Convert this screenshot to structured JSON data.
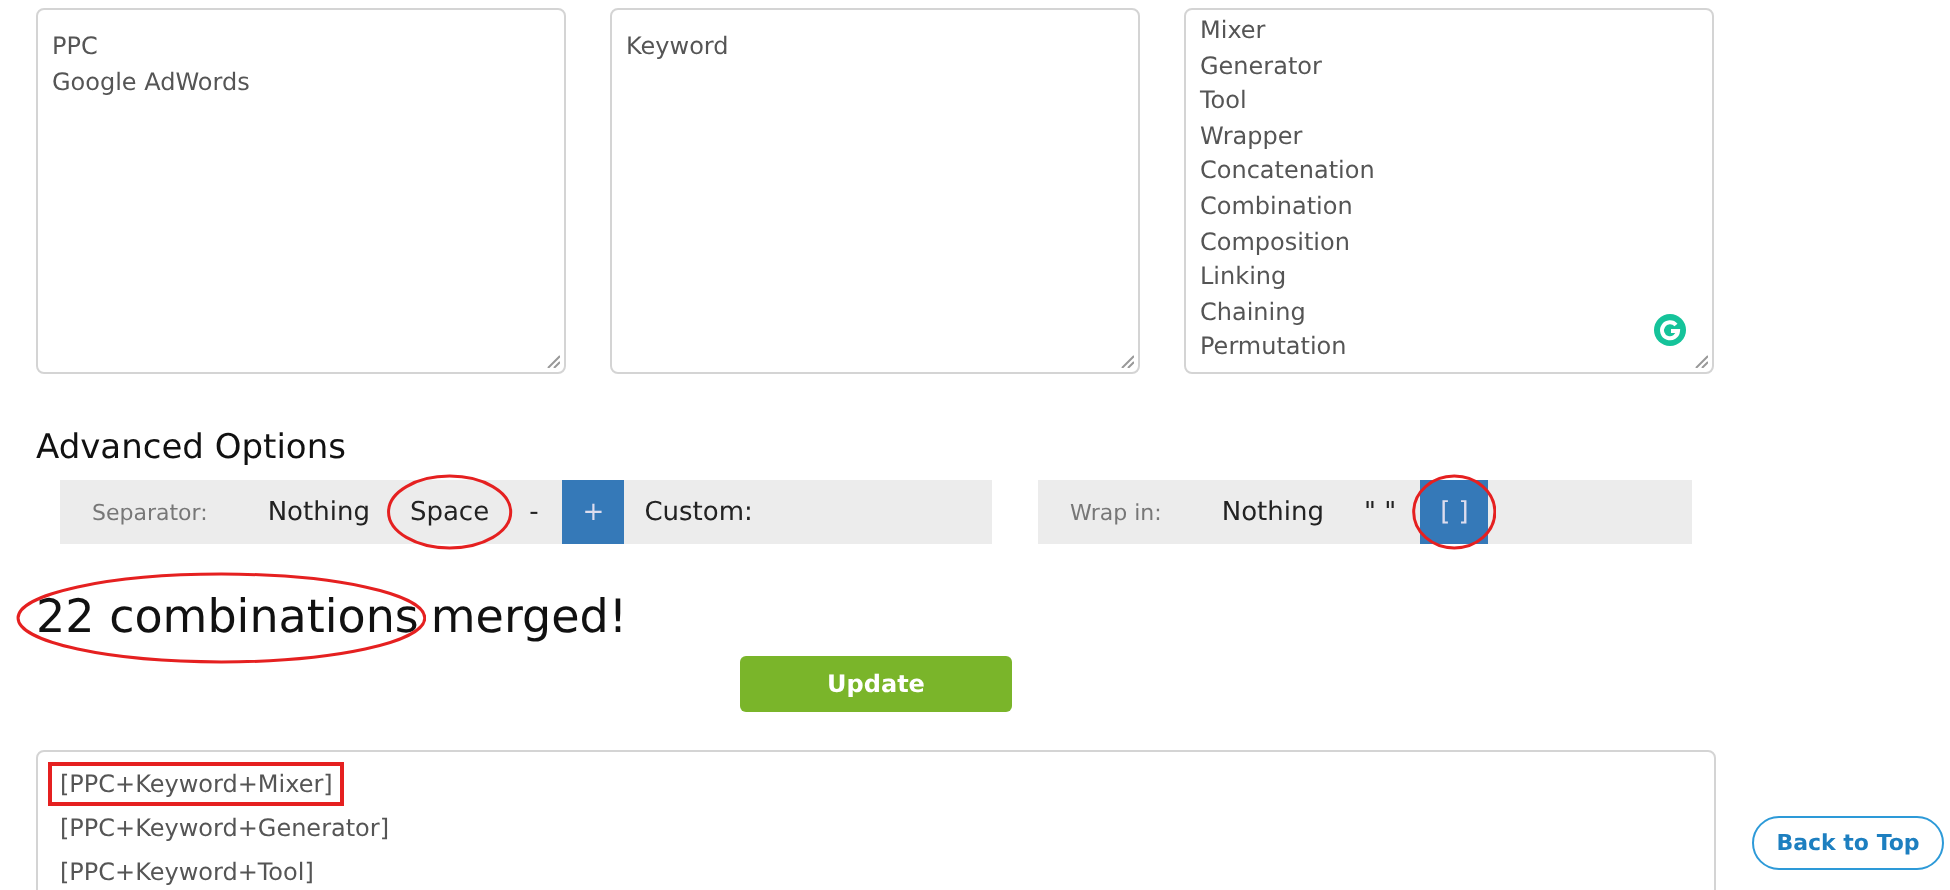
{
  "inputs": [
    {
      "value": "PPC\nGoogle AdWords",
      "grammarly": false
    },
    {
      "value": "Keyword",
      "grammarly": false
    },
    {
      "value": "Mixer\nGenerator\nTool\nWrapper\nConcatenation\nCombination\nComposition\nLinking\nChaining\nPermutation",
      "grammarly": true
    }
  ],
  "advanced_options": {
    "title": "Advanced Options",
    "separator": {
      "label": "Separator:",
      "options": [
        {
          "label": "Nothing",
          "selected": false,
          "circled": false
        },
        {
          "label": "Space",
          "selected": false,
          "circled": true
        },
        {
          "label": "-",
          "selected": false,
          "circled": false
        },
        {
          "label": "+",
          "selected": true,
          "circled": false
        }
      ],
      "custom_label": "Custom:"
    },
    "wrap": {
      "label": "Wrap in:",
      "options": [
        {
          "label": "Nothing",
          "selected": false,
          "circled": false
        },
        {
          "label": "\" \"",
          "selected": false,
          "circled": false
        },
        {
          "label": "[ ]",
          "selected": true,
          "circled": true
        }
      ]
    }
  },
  "result_summary": {
    "count": "22 combinations",
    "count_circled": true,
    "rest": "merged!"
  },
  "update_button": "Update",
  "results": [
    {
      "text": "[PPC+Keyword+Mixer]",
      "boxed": true
    },
    {
      "text": "[PPC+Keyword+Generator]",
      "boxed": false
    },
    {
      "text": "[PPC+Keyword+Tool]",
      "boxed": false
    }
  ],
  "back_to_top": "Back to Top"
}
